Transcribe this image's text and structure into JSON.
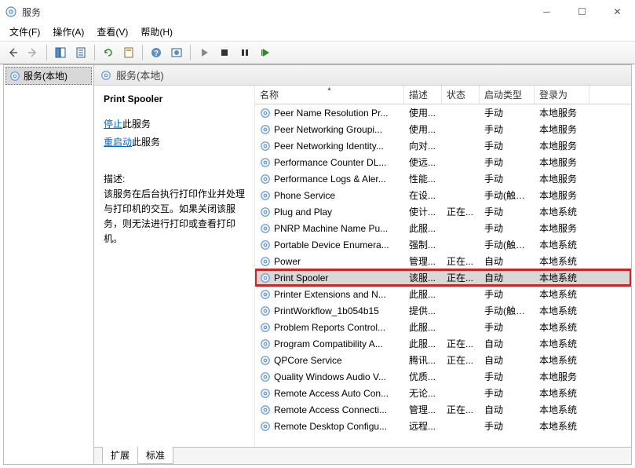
{
  "window": {
    "title": "服务"
  },
  "menu": {
    "file": "文件(F)",
    "action": "操作(A)",
    "view": "查看(V)",
    "help": "帮助(H)"
  },
  "tree": {
    "root": "服务(本地)"
  },
  "pane": {
    "header": "服务(本地)"
  },
  "detail": {
    "service_name": "Print Spooler",
    "stop_link": "停止",
    "stop_suffix": "此服务",
    "restart_link": "重启动",
    "restart_suffix": "此服务",
    "desc_label": "描述:",
    "desc_text": "该服务在后台执行打印作业并处理与打印机的交互。如果关闭该服务，则无法进行打印或查看打印机。"
  },
  "columns": {
    "name": "名称",
    "desc": "描述",
    "status": "状态",
    "startup": "启动类型",
    "logon": "登录为"
  },
  "tabs": {
    "extended": "扩展",
    "standard": "标准"
  },
  "services": [
    {
      "name": "Peer Name Resolution Pr...",
      "desc": "使用...",
      "status": "",
      "startup": "手动",
      "logon": "本地服务"
    },
    {
      "name": "Peer Networking Groupi...",
      "desc": "使用...",
      "status": "",
      "startup": "手动",
      "logon": "本地服务"
    },
    {
      "name": "Peer Networking Identity...",
      "desc": "向对...",
      "status": "",
      "startup": "手动",
      "logon": "本地服务"
    },
    {
      "name": "Performance Counter DL...",
      "desc": "使远...",
      "status": "",
      "startup": "手动",
      "logon": "本地服务"
    },
    {
      "name": "Performance Logs & Aler...",
      "desc": "性能...",
      "status": "",
      "startup": "手动",
      "logon": "本地服务"
    },
    {
      "name": "Phone Service",
      "desc": "在设...",
      "status": "",
      "startup": "手动(触发...",
      "logon": "本地服务"
    },
    {
      "name": "Plug and Play",
      "desc": "使计...",
      "status": "正在...",
      "startup": "手动",
      "logon": "本地系统"
    },
    {
      "name": "PNRP Machine Name Pu...",
      "desc": "此服...",
      "status": "",
      "startup": "手动",
      "logon": "本地服务"
    },
    {
      "name": "Portable Device Enumera...",
      "desc": "强制...",
      "status": "",
      "startup": "手动(触发...",
      "logon": "本地系统"
    },
    {
      "name": "Power",
      "desc": "管理...",
      "status": "正在...",
      "startup": "自动",
      "logon": "本地系统"
    },
    {
      "name": "Print Spooler",
      "desc": "该服...",
      "status": "正在...",
      "startup": "自动",
      "logon": "本地系统",
      "selected": true,
      "highlighted": true
    },
    {
      "name": "Printer Extensions and N...",
      "desc": "此服...",
      "status": "",
      "startup": "手动",
      "logon": "本地系统"
    },
    {
      "name": "PrintWorkflow_1b054b15",
      "desc": "提供...",
      "status": "",
      "startup": "手动(触发...",
      "logon": "本地系统"
    },
    {
      "name": "Problem Reports Control...",
      "desc": "此服...",
      "status": "",
      "startup": "手动",
      "logon": "本地系统"
    },
    {
      "name": "Program Compatibility A...",
      "desc": "此服...",
      "status": "正在...",
      "startup": "自动",
      "logon": "本地系统"
    },
    {
      "name": "QPCore Service",
      "desc": "腾讯...",
      "status": "正在...",
      "startup": "自动",
      "logon": "本地系统"
    },
    {
      "name": "Quality Windows Audio V...",
      "desc": "优质...",
      "status": "",
      "startup": "手动",
      "logon": "本地服务"
    },
    {
      "name": "Remote Access Auto Con...",
      "desc": "无论...",
      "status": "",
      "startup": "手动",
      "logon": "本地系统"
    },
    {
      "name": "Remote Access Connecti...",
      "desc": "管理...",
      "status": "正在...",
      "startup": "自动",
      "logon": "本地系统"
    },
    {
      "name": "Remote Desktop Configu...",
      "desc": "远程...",
      "status": "",
      "startup": "手动",
      "logon": "本地系统"
    }
  ]
}
